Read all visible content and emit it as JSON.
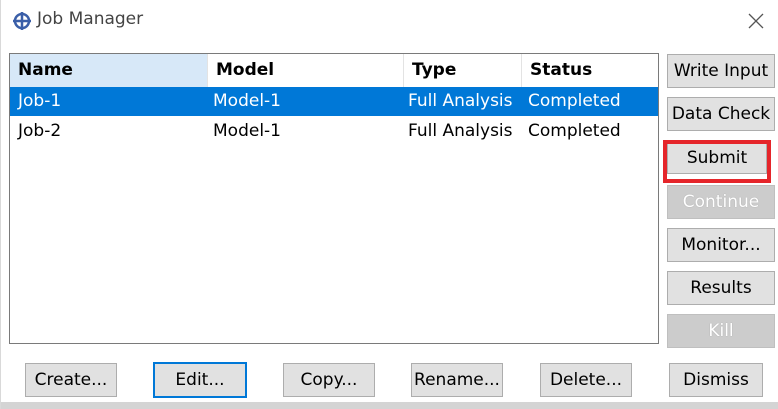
{
  "window": {
    "title": "Job Manager",
    "app_icon": "abaqus-crosshair-icon",
    "close_icon": "close-icon"
  },
  "table": {
    "columns": [
      "Name",
      "Model",
      "Type",
      "Status"
    ],
    "rows": [
      {
        "name": "Job-1",
        "model": "Model-1",
        "type": "Full Analysis",
        "status": "Completed",
        "selected": true
      },
      {
        "name": "Job-2",
        "model": "Model-1",
        "type": "Full Analysis",
        "status": "Completed",
        "selected": false
      }
    ]
  },
  "side_buttons": {
    "write_input": "Write Input",
    "data_check": "Data Check",
    "submit": "Submit",
    "continue": "Continue",
    "monitor": "Monitor...",
    "results": "Results",
    "kill": "Kill"
  },
  "bottom_buttons": {
    "create": "Create...",
    "edit": "Edit...",
    "copy": "Copy...",
    "rename": "Rename...",
    "delete": "Delete...",
    "dismiss": "Dismiss"
  },
  "colors": {
    "selection": "#0078d7",
    "highlight": "#e5252a"
  }
}
